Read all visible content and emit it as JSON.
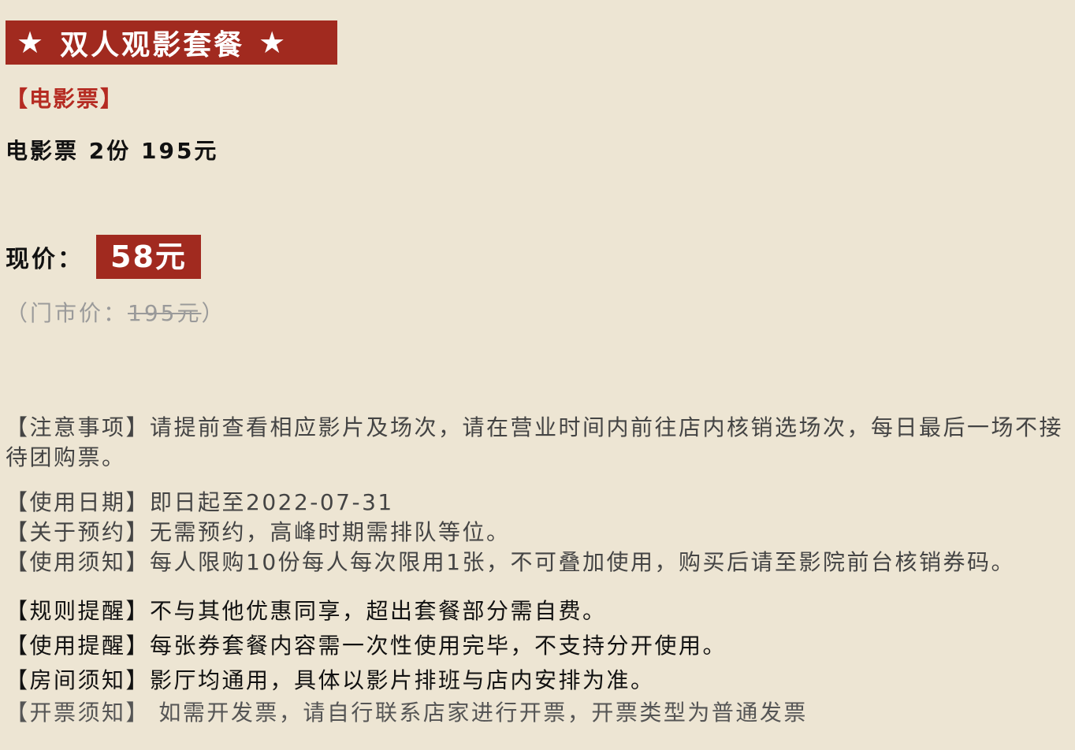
{
  "banner": {
    "star_left": "★",
    "title": "双人观影套餐",
    "star_right": "★"
  },
  "section": {
    "tag": "【电影票】"
  },
  "item": {
    "line": "电影票 2份 195元"
  },
  "price": {
    "label": "现价：",
    "current": "58元",
    "original_prefix": "（门市价：",
    "original_value": "195元",
    "original_suffix": "）"
  },
  "notes": {
    "attention": "【注意事项】请提前查看相应影片及场次，请在营业时间内前往店内核销选场次，每日最后一场不接待团购票。",
    "date": "【使用日期】即日起至2022-07-31",
    "reserve": "【关于预约】无需预约，高峰时期需排队等位。",
    "usage": "【使用须知】每人限购10份每人每次限用1张，不可叠加使用，购买后请至影院前台核销券码。"
  },
  "rules": {
    "rule": "【规则提醒】不与其他优惠同享，超出套餐部分需自费。",
    "use": "【使用提醒】每张券套餐内容需一次性使用完毕，不支持分开使用。",
    "room": "【房间须知】影厅均通用，具体以影片排班与店内安排为准。",
    "invoice": "【开票须知】 如需开发票，请自行联系店家进行开票，开票类型为普通发票"
  },
  "colors": {
    "background": "#ede5d3",
    "accent": "#a12a1f",
    "section_red": "#b52b22",
    "muted": "#9a9a9a"
  }
}
